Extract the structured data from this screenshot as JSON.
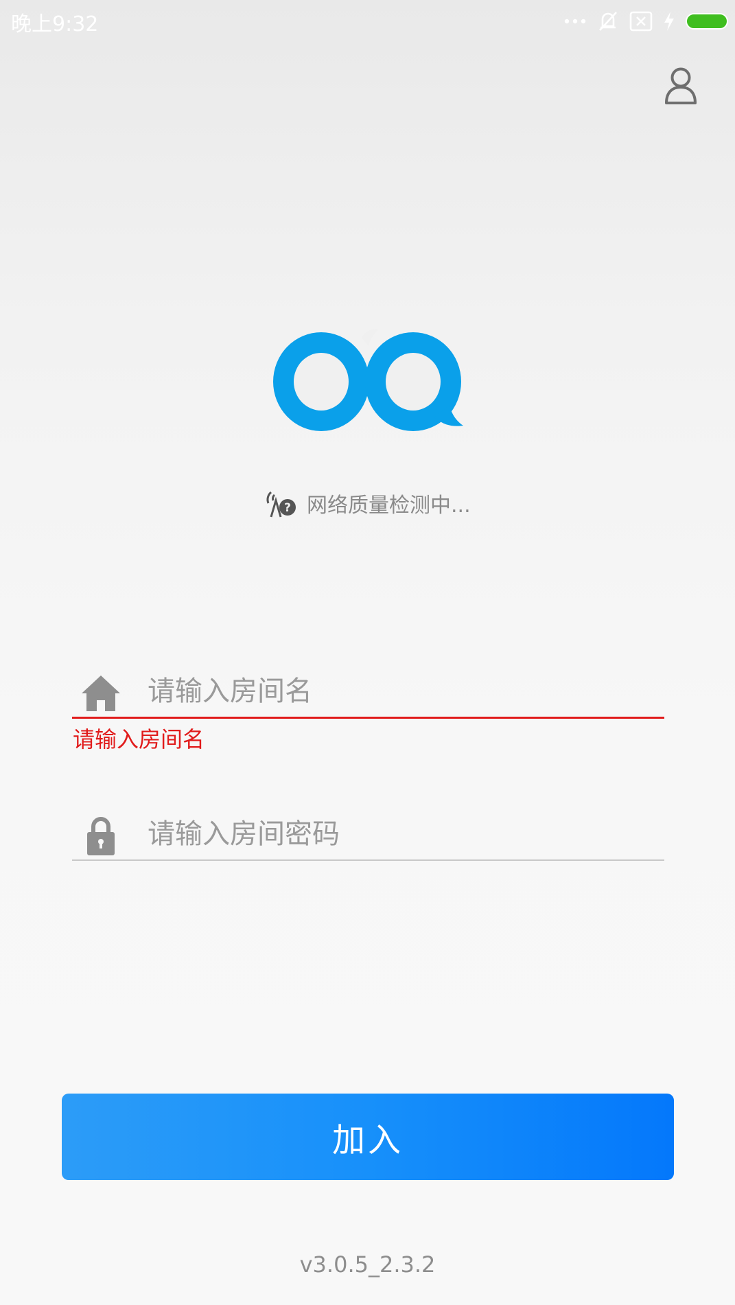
{
  "status_bar": {
    "time": "晚上9:32",
    "icons": [
      "more-dots-icon",
      "vibrate-off-icon",
      "sim-x-icon",
      "charging-bolt-icon",
      "battery-icon"
    ],
    "battery_color": "#3fbe1f"
  },
  "header": {
    "profile_icon": "user-profile-icon"
  },
  "logo": {
    "color": "#0aa0ea"
  },
  "network": {
    "icon": "network-check-icon",
    "status_text": "网络质量检测中..."
  },
  "room_name": {
    "icon": "home-icon",
    "placeholder": "请输入房间名",
    "value": "",
    "error_text": "请输入房间名",
    "error_color": "#e11b1b"
  },
  "room_password": {
    "icon": "lock-icon",
    "placeholder": "请输入房间密码",
    "value": ""
  },
  "join_button": {
    "label": "加入",
    "color": "#1790fa"
  },
  "version": "v3.0.5_2.3.2"
}
